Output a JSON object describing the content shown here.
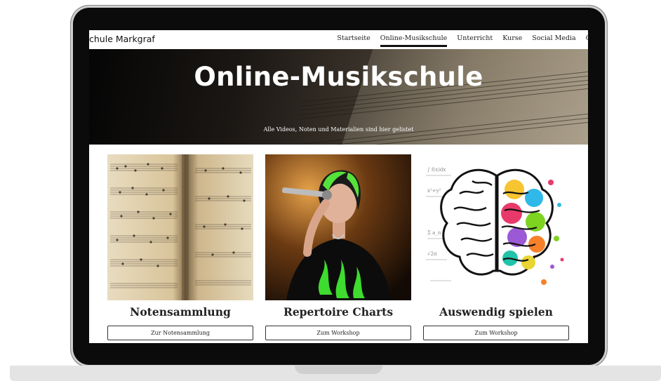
{
  "site": {
    "brand": "chule Markgraf"
  },
  "nav": {
    "items": [
      "Startseite",
      "Online-Musikschule",
      "Unterricht",
      "Kurse",
      "Social Media",
      "C"
    ],
    "active_index": 1
  },
  "hero": {
    "title": "Online-Musikschule",
    "subtitle": "Alle Videos, Noten und Materialien sind hier gelistet"
  },
  "cards": [
    {
      "title": "Notensammlung",
      "button": "Zur Notensammlung",
      "image": "sheet-music-book-photo"
    },
    {
      "title": "Repertoire Charts",
      "button": "Zum Workshop",
      "image": "singer-with-microphone-photo"
    },
    {
      "title": "Auswendig spielen",
      "button": "Zum Workshop",
      "image": "colorful-brain-illustration"
    }
  ],
  "colors": {
    "hero_text": "#ffffff",
    "nav_underline": "#111111",
    "device_frame": "#0b0b0b"
  }
}
